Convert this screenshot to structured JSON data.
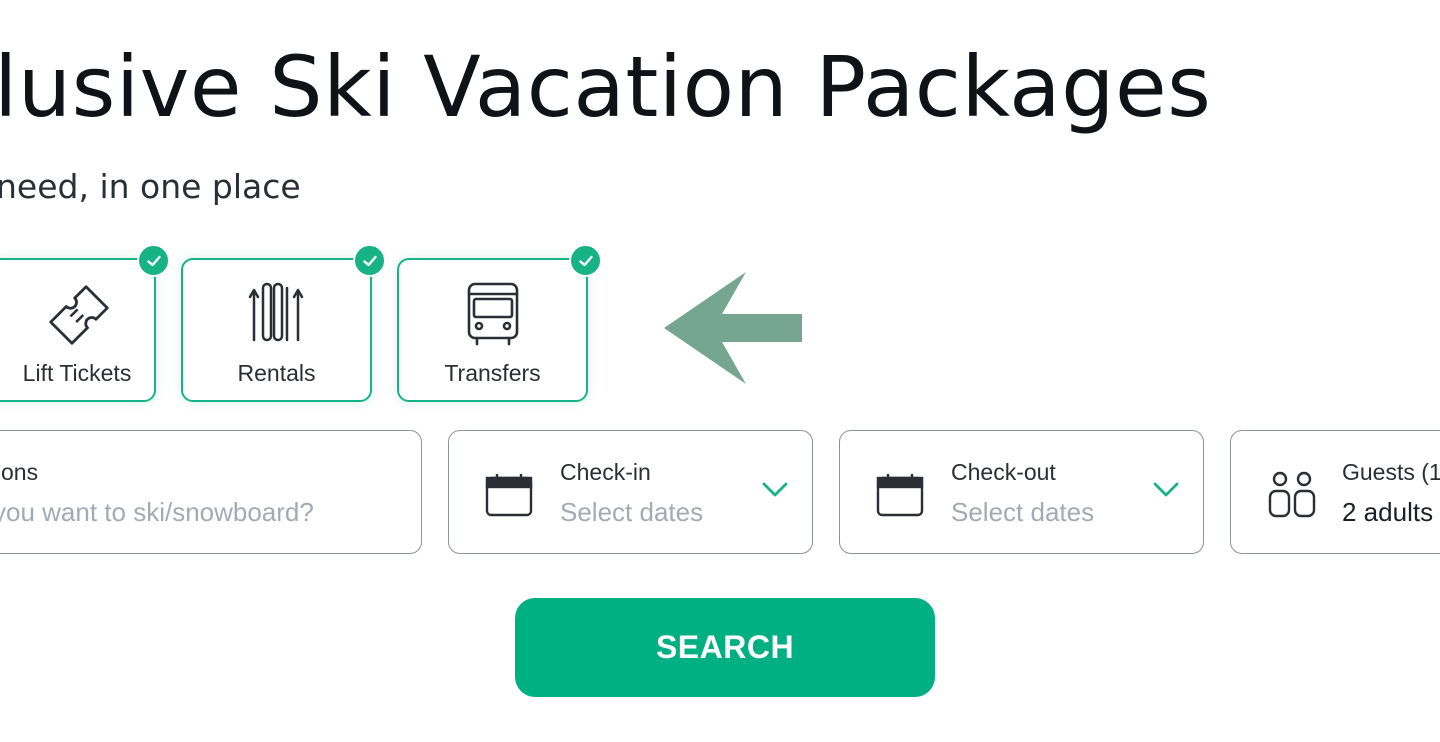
{
  "hero": {
    "title": "lusive Ski Vacation Packages",
    "subtitle": " need, in one place"
  },
  "products": [
    {
      "label": "Lift Tickets",
      "icon": "ticket-icon",
      "selected": true
    },
    {
      "label": "Rentals",
      "icon": "ski-rentals-icon",
      "selected": true
    },
    {
      "label": "Transfers",
      "icon": "bus-icon",
      "selected": true
    }
  ],
  "annotation": {
    "icon": "left-arrow-icon",
    "color": "#6fa08c"
  },
  "search": {
    "destination": {
      "title": "ons",
      "placeholder": "you want to ski/snowboard?"
    },
    "checkin": {
      "title": "Check-in",
      "placeholder": "Select dates",
      "icon": "calendar-icon"
    },
    "checkout": {
      "title": "Check-out",
      "placeholder": "Select dates",
      "icon": "calendar-icon"
    },
    "guests": {
      "title": "Guests (1",
      "value": "2 adults",
      "icon": "guests-icon"
    },
    "button_label": "SEARCH"
  },
  "colors": {
    "accent": "#17b387",
    "button": "#00b083",
    "border": "#8d939b",
    "placeholder": "#a4aab2"
  }
}
